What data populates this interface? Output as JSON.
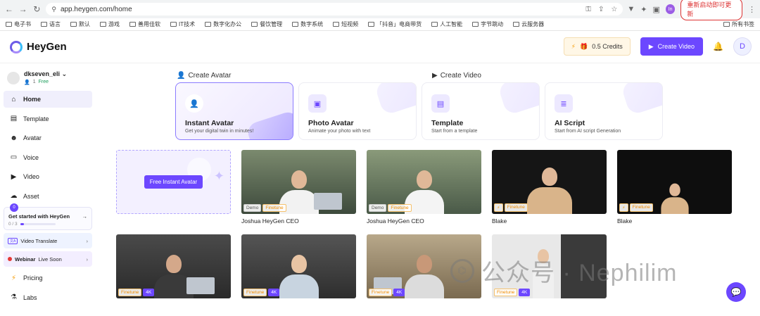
{
  "browser": {
    "url": "app.heygen.com/home",
    "update_label": "重新启动即可更新",
    "profile_initial": "In",
    "bookmarks": [
      "电子书",
      "语言",
      "默认",
      "游戏",
      "善用佳软",
      "IT技术",
      "数字化办公",
      "餐饮管理",
      "数字系统",
      "短视频",
      "「抖音」电商带货",
      "人工智能",
      "字节跳动",
      "云服务器"
    ],
    "bookmarks_right": "所有书签"
  },
  "header": {
    "logo_text": "HeyGen",
    "credits": "0.5 Credits",
    "create_video": "Create Video",
    "avatar_initial": "D"
  },
  "sidebar": {
    "workspace_name": "dkseven_eli",
    "workspace_members": "1",
    "workspace_plan": "Free",
    "items": [
      {
        "label": "Home",
        "icon": "home-icon"
      },
      {
        "label": "Template",
        "icon": "template-icon"
      },
      {
        "label": "Avatar",
        "icon": "avatar-icon"
      },
      {
        "label": "Voice",
        "icon": "voice-icon"
      },
      {
        "label": "Video",
        "icon": "video-icon"
      },
      {
        "label": "Asset",
        "icon": "asset-icon"
      }
    ],
    "getting_started": {
      "badge": "0",
      "title": "Get started with HeyGen",
      "progress": "0 / 3",
      "fraction": 0.1
    },
    "video_translate": "Video Translate",
    "webinar_bold": "Webinar",
    "webinar_rest": "Live Soon",
    "pricing": "Pricing",
    "labs": "Labs"
  },
  "create_avatar": {
    "label": "Create Avatar",
    "cards": [
      {
        "title": "Instant Avatar",
        "subtitle": "Get your digital twin in minutes!"
      },
      {
        "title": "Photo Avatar",
        "subtitle": "Animate your photo with text"
      }
    ]
  },
  "create_video": {
    "label": "Create Video",
    "cards": [
      {
        "title": "Template",
        "subtitle": "Start from a template"
      },
      {
        "title": "AI Script",
        "subtitle": "Start from AI script Generation"
      }
    ]
  },
  "avatars": {
    "free_button": "Free Instant Avatar",
    "tiles": [
      {
        "label": "Joshua HeyGen CEO",
        "badges": [
          "Demo",
          "Finetune"
        ]
      },
      {
        "label": "Joshua HeyGen CEO",
        "badges": [
          "Demo",
          "Finetune"
        ]
      },
      {
        "label": "Blake",
        "badges": [
          "Finetune"
        ]
      },
      {
        "label": "Blake",
        "badges": [
          "Finetune"
        ]
      },
      {
        "label": "",
        "badges": [
          "Finetune",
          "4K"
        ]
      },
      {
        "label": "",
        "badges": [
          "Finetune",
          "4K"
        ]
      },
      {
        "label": "",
        "badges": [
          "Finetune",
          "4K"
        ]
      },
      {
        "label": "",
        "badges": [
          "Finetune",
          "4K"
        ]
      }
    ]
  },
  "watermark": "公众号 · Nephilim",
  "colors": {
    "accent": "#6c47ff",
    "finetune": "#f08c00"
  }
}
